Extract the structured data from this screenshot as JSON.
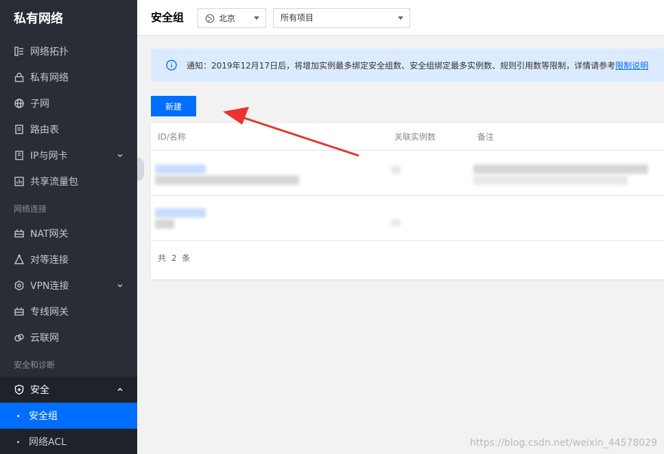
{
  "sidebar": {
    "title": "私有网络",
    "items_top": [
      {
        "label": "网络拓扑",
        "icon": "topology-icon"
      },
      {
        "label": "私有网络",
        "icon": "lock-icon"
      },
      {
        "label": "子网",
        "icon": "globe-icon"
      },
      {
        "label": "路由表",
        "icon": "document-icon"
      },
      {
        "label": "IP与网卡",
        "icon": "ip-card-icon"
      },
      {
        "label": "共享流量包",
        "icon": "chart-icon"
      }
    ],
    "group_network": "网络连接",
    "items_network": [
      {
        "label": "NAT网关",
        "icon": "gateway-icon"
      },
      {
        "label": "对等连接",
        "icon": "peering-icon"
      },
      {
        "label": "VPN连接",
        "icon": "vpn-icon"
      },
      {
        "label": "专线网关",
        "icon": "gateway-icon"
      },
      {
        "label": "云联网",
        "icon": "cloud-link-icon"
      }
    ],
    "group_security": "安全和诊断",
    "security": {
      "label": "安全",
      "icon": "shield-icon"
    },
    "security_sub": [
      {
        "label": "安全组"
      },
      {
        "label": "网络ACL"
      }
    ]
  },
  "header": {
    "title": "安全组",
    "region": "北京",
    "project": "所有项目"
  },
  "notice": {
    "text": "通知：2019年12月17日后，将增加实例最多绑定安全组数、安全组绑定最多实例数、规则引用数等限制，详情请参考",
    "link": "限制说明"
  },
  "toolbar": {
    "new_label": "新建"
  },
  "table": {
    "columns": [
      "ID/名称",
      "关联实例数",
      "备注"
    ],
    "footer": "共 2 条"
  },
  "watermark": "https://blog.csdn.net/weixin_44578029",
  "colors": {
    "accent": "#006eff",
    "sidebar_bg": "#292d36",
    "arrow": "#e8332e"
  }
}
